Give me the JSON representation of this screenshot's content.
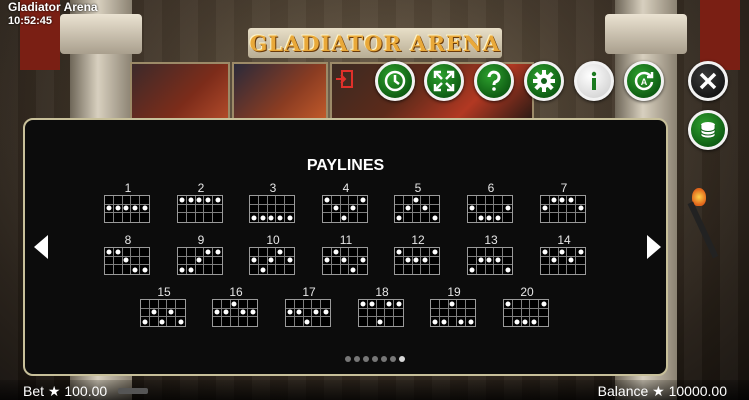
{
  "app": {
    "title": "Gladiator Arena",
    "clock": "10:52:45"
  },
  "logo": {
    "text": "GLADIATOR ARENA"
  },
  "toolbar": {
    "buttons": [
      {
        "name": "autoplay-button",
        "icon": "clock-icon"
      },
      {
        "name": "fullscreen-button",
        "icon": "expand-arrows-icon"
      },
      {
        "name": "help-button",
        "icon": "question-mark-icon"
      },
      {
        "name": "settings-button",
        "icon": "gear-icon"
      },
      {
        "name": "info-button",
        "icon": "info-icon"
      },
      {
        "name": "auto-spin-button",
        "icon": "auto-refresh-icon"
      }
    ],
    "close_icon": "close-icon",
    "coins_icon": "coin-stack-icon",
    "exit_icon": "exit-door-icon"
  },
  "paylines": {
    "title": "PAYLINES",
    "lines": [
      {
        "num": "1",
        "rows": [
          1,
          1,
          1,
          1,
          1
        ]
      },
      {
        "num": "2",
        "rows": [
          0,
          0,
          0,
          0,
          0
        ]
      },
      {
        "num": "3",
        "rows": [
          2,
          2,
          2,
          2,
          2
        ]
      },
      {
        "num": "4",
        "rows": [
          0,
          1,
          2,
          1,
          0
        ]
      },
      {
        "num": "5",
        "rows": [
          2,
          1,
          0,
          1,
          2
        ]
      },
      {
        "num": "6",
        "rows": [
          1,
          2,
          2,
          2,
          1
        ]
      },
      {
        "num": "7",
        "rows": [
          1,
          0,
          0,
          0,
          1
        ]
      },
      {
        "num": "8",
        "rows": [
          0,
          0,
          1,
          2,
          2
        ]
      },
      {
        "num": "9",
        "rows": [
          2,
          2,
          1,
          0,
          0
        ]
      },
      {
        "num": "10",
        "rows": [
          1,
          2,
          1,
          0,
          1
        ]
      },
      {
        "num": "11",
        "rows": [
          1,
          0,
          1,
          2,
          1
        ]
      },
      {
        "num": "12",
        "rows": [
          0,
          1,
          1,
          1,
          0
        ]
      },
      {
        "num": "13",
        "rows": [
          2,
          1,
          1,
          1,
          2
        ]
      },
      {
        "num": "14",
        "rows": [
          0,
          1,
          0,
          1,
          0
        ]
      },
      {
        "num": "15",
        "rows": [
          2,
          1,
          2,
          1,
          2
        ]
      },
      {
        "num": "16",
        "rows": [
          1,
          1,
          0,
          1,
          1
        ]
      },
      {
        "num": "17",
        "rows": [
          1,
          1,
          2,
          1,
          1
        ]
      },
      {
        "num": "18",
        "rows": [
          0,
          0,
          2,
          0,
          0
        ]
      },
      {
        "num": "19",
        "rows": [
          2,
          2,
          0,
          2,
          2
        ]
      },
      {
        "num": "20",
        "rows": [
          0,
          2,
          2,
          2,
          0
        ]
      }
    ]
  },
  "pagination": {
    "count": 7,
    "active": 7
  },
  "footer": {
    "bet": "Bet ★ 100.00",
    "balance": "Balance ★ 10000.00"
  },
  "colors": {
    "accent_green": "#1a7a1f",
    "panel_border": "#c8c09a",
    "logo_gold": "#e9a93a"
  }
}
